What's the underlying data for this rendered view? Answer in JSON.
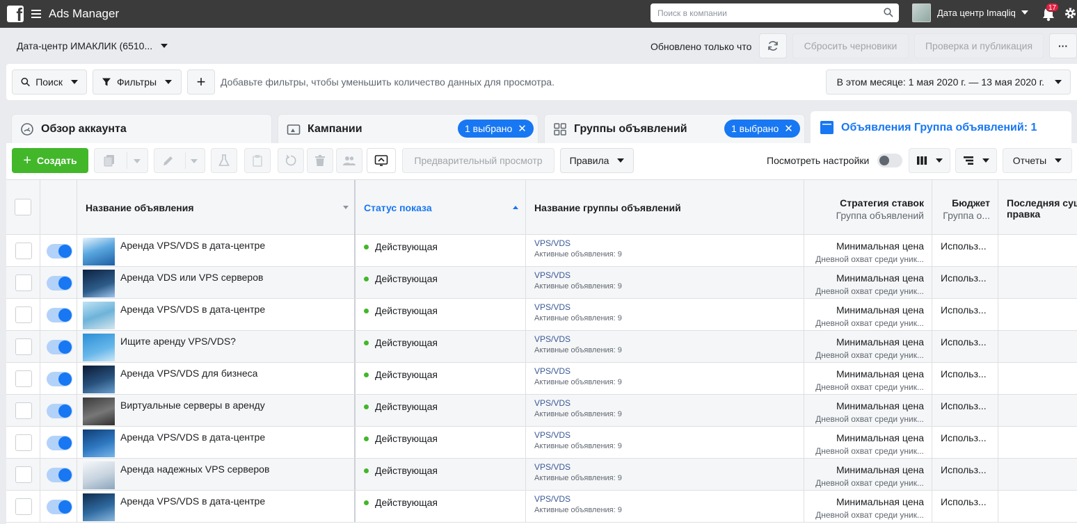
{
  "topbar": {
    "app_title": "Ads Manager",
    "search_placeholder": "Поиск в компании",
    "account_name": "Дата центр Imaqliq",
    "notifications_count": "17"
  },
  "account_row": {
    "account_select": "Дата-центр ИМАКЛИК (6510...",
    "updated_text": "Обновлено только что",
    "discard_label": "Сбросить черновики",
    "review_label": "Проверка и публикация",
    "more_label": "···"
  },
  "filterbar": {
    "search_label": "Поиск",
    "filters_label": "Фильтры",
    "add_label": "+",
    "hint": "Добавьте фильтры, чтобы уменьшить количество данных для просмотра.",
    "date_range": "В этом месяце: 1 мая 2020 г. — 13 мая 2020 г."
  },
  "tabs": {
    "overview": "Обзор аккаунта",
    "campaigns": "Кампании",
    "campaigns_selected": "1 выбрано",
    "adsets": "Группы объявлений",
    "adsets_selected": "1 выбрано",
    "ads": "Объявления Группа объявлений: 1"
  },
  "toolbar": {
    "create_label": "Создать",
    "preview_label": "Предварительный просмотр",
    "rules_label": "Правила",
    "view_settings_label": "Посмотреть настройки",
    "reports_label": "Отчеты"
  },
  "table": {
    "columns": {
      "ad_name": "Название объявления",
      "delivery": "Статус показа",
      "adset_name": "Название группы объявлений",
      "bid_strategy": "Стратегия ставок",
      "bid_strategy_sub": "Группа объявлений",
      "budget": "Бюджет",
      "budget_sub": "Группа о...",
      "last_change_1": "Последняя сущ",
      "last_change_2": "правка"
    },
    "rows": [
      {
        "ad_name": "Аренда VPS/VDS в дата-центре",
        "status": "Действующая",
        "adset": "VPS/VDS",
        "adset_sub": "Активные объявления: 9",
        "bid": "Минимальная цена",
        "bid_sub": "Дневной охват среди уник...",
        "budget": "Использ..."
      },
      {
        "ad_name": "Аренда VDS или VPS серверов",
        "status": "Действующая",
        "adset": "VPS/VDS",
        "adset_sub": "Активные объявления: 9",
        "bid": "Минимальная цена",
        "bid_sub": "Дневной охват среди уник...",
        "budget": "Использ..."
      },
      {
        "ad_name": "Аренда VPS/VDS в дата-центре",
        "status": "Действующая",
        "adset": "VPS/VDS",
        "adset_sub": "Активные объявления: 9",
        "bid": "Минимальная цена",
        "bid_sub": "Дневной охват среди уник...",
        "budget": "Использ..."
      },
      {
        "ad_name": "Ищите аренду VPS/VDS?",
        "status": "Действующая",
        "adset": "VPS/VDS",
        "adset_sub": "Активные объявления: 9",
        "bid": "Минимальная цена",
        "bid_sub": "Дневной охват среди уник...",
        "budget": "Использ..."
      },
      {
        "ad_name": "Аренда VPS/VDS для бизнеса",
        "status": "Действующая",
        "adset": "VPS/VDS",
        "adset_sub": "Активные объявления: 9",
        "bid": "Минимальная цена",
        "bid_sub": "Дневной охват среди уник...",
        "budget": "Использ..."
      },
      {
        "ad_name": "Виртуальные серверы в аренду",
        "status": "Действующая",
        "adset": "VPS/VDS",
        "adset_sub": "Активные объявления: 9",
        "bid": "Минимальная цена",
        "bid_sub": "Дневной охват среди уник...",
        "budget": "Использ..."
      },
      {
        "ad_name": "Аренда VPS/VDS в дата-центре",
        "status": "Действующая",
        "adset": "VPS/VDS",
        "adset_sub": "Активные объявления: 9",
        "bid": "Минимальная цена",
        "bid_sub": "Дневной охват среди уник...",
        "budget": "Использ..."
      },
      {
        "ad_name": "Аренда надежных VPS серверов",
        "status": "Действующая",
        "adset": "VPS/VDS",
        "adset_sub": "Активные объявления: 9",
        "bid": "Минимальная цена",
        "bid_sub": "Дневной охват среди уник...",
        "budget": "Использ..."
      },
      {
        "ad_name": "Аренда VPS/VDS в дата-центре",
        "status": "Действующая",
        "adset": "VPS/VDS",
        "adset_sub": "Активные объявления: 9",
        "bid": "Минимальная цена",
        "bid_sub": "Дневной охват среди уник...",
        "budget": "Использ..."
      }
    ]
  },
  "colors": {
    "accent": "#1877f2",
    "create_green": "#42b72a",
    "topbar": "#3b3b3b"
  }
}
